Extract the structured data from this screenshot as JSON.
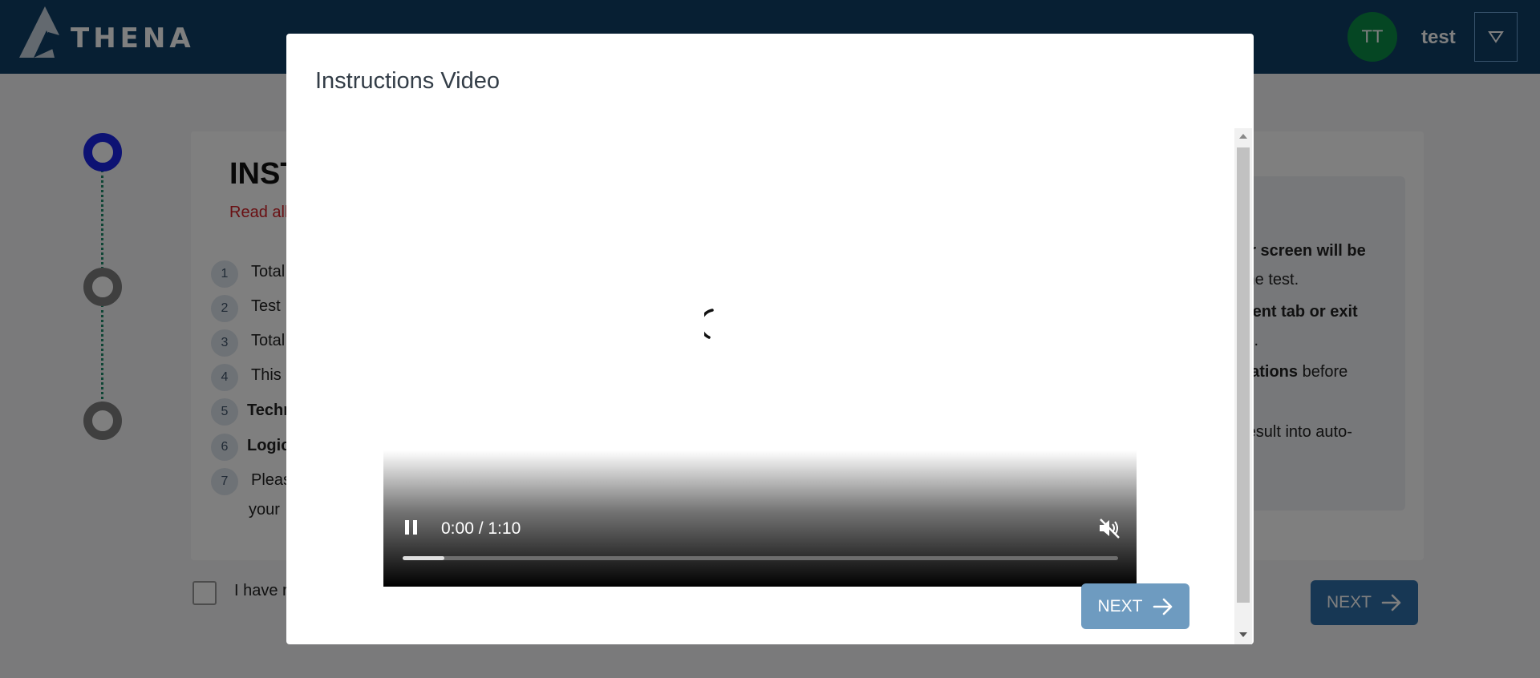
{
  "header": {
    "logo_text": "THENA",
    "avatar_initials": "TT",
    "username": "test",
    "brand_color": "#0e3e67",
    "avatar_color": "#0b8c46"
  },
  "stepper": {
    "steps": [
      {
        "state": "active"
      },
      {
        "state": "todo"
      },
      {
        "state": "todo"
      }
    ]
  },
  "instructions": {
    "title": "INST",
    "subtitle": "Read all",
    "items": [
      {
        "num": "1",
        "text": "Total"
      },
      {
        "num": "2",
        "text": "Test"
      },
      {
        "num": "3",
        "text": "Total"
      },
      {
        "num": "4",
        "text": "This"
      },
      {
        "num": "5",
        "text": "Techr"
      },
      {
        "num": "6",
        "text": "Logic"
      },
      {
        "num": "7",
        "text": "Pleas"
      }
    ],
    "item7_cont": "your",
    "note": {
      "line1_bold": "ur screen will be",
      "line2": " the test.",
      "line3_bold": "rrent tab or exit",
      "line4": "ts.",
      "line5_bold": "cations",
      "line5_rest": " before",
      "line6": "result into auto-"
    },
    "agree_text": "I have r",
    "next_label": "NEXT"
  },
  "modal": {
    "title": "Instructions Video",
    "video": {
      "time": "0:00 / 1:10",
      "progress": 0.058,
      "muted": true,
      "playing": true,
      "play_icon": "pause-icon",
      "volume_icon": "volume-muted-icon"
    },
    "next_label": "NEXT"
  }
}
